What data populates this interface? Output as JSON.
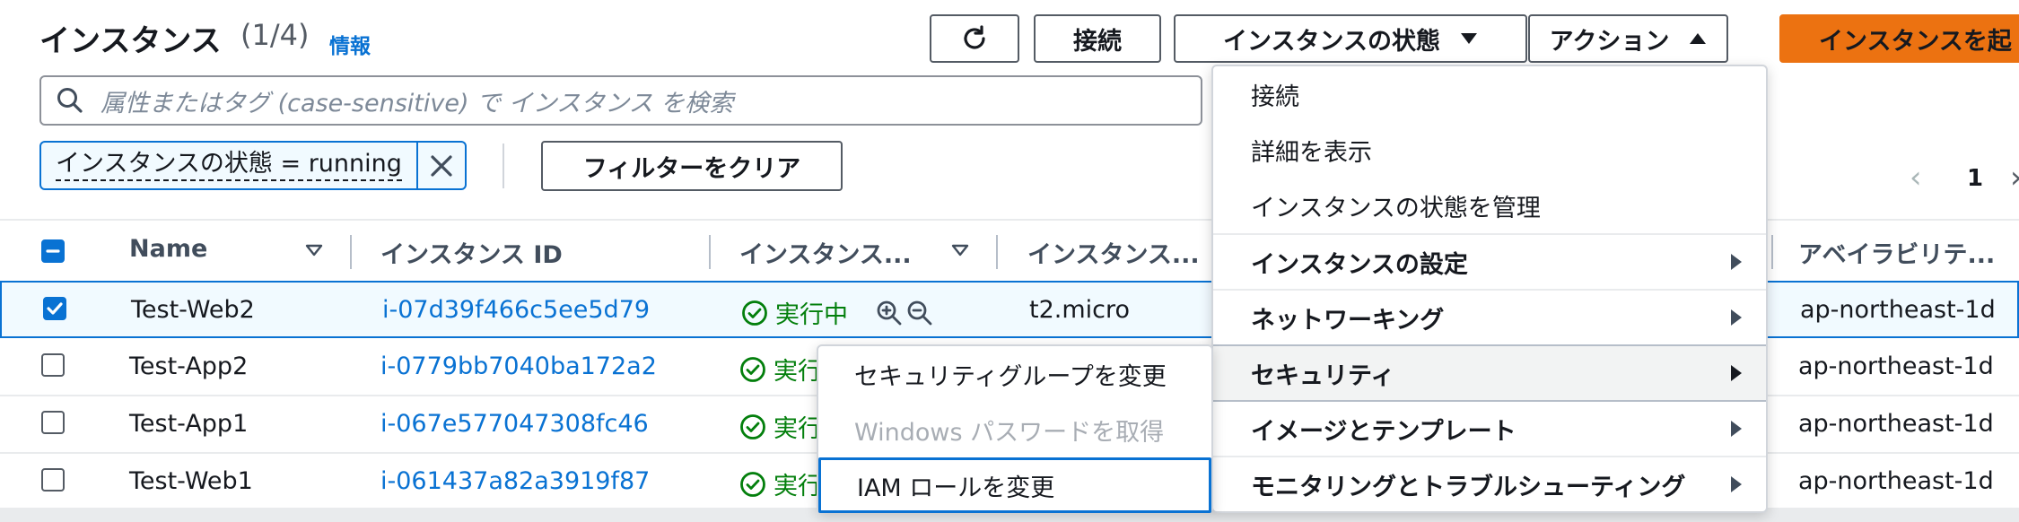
{
  "header": {
    "title": "インスタンス",
    "count": "(1/4)",
    "info_link": "情報"
  },
  "toolbar": {
    "connect_label": "接続",
    "instance_state_label": "インスタンスの状態",
    "actions_label": "アクション",
    "launch_label": "インスタンスを起"
  },
  "search": {
    "placeholder": "属性またはタグ (case-sensitive) で インスタンス を検索"
  },
  "filter": {
    "token_label": "インスタンスの状態 = running",
    "clear_label": "フィルターをクリア"
  },
  "pagination": {
    "current_page": "1"
  },
  "table": {
    "columns": {
      "name": "Name",
      "instance_id": "インスタンス ID",
      "instance_state": "インスタンス...",
      "instance_type": "インスタンス...",
      "availability_zone": "アベイラビリテ..."
    },
    "rows": [
      {
        "name": "Test-Web2",
        "id": "i-07d39f466c5ee5d79",
        "state": "実行中",
        "type": "t2.micro",
        "az": "ap-northeast-1d",
        "selected": true
      },
      {
        "name": "Test-App2",
        "id": "i-0779bb7040ba172a2",
        "state": "実行",
        "type": "",
        "az": "ap-northeast-1d",
        "selected": false
      },
      {
        "name": "Test-App1",
        "id": "i-067e577047308fc46",
        "state": "実行",
        "type": "",
        "az": "ap-northeast-1d",
        "selected": false
      },
      {
        "name": "Test-Web1",
        "id": "i-061437a82a3919f87",
        "state": "実行",
        "type": "",
        "az": "ap-northeast-1d",
        "selected": false
      }
    ]
  },
  "actions_menu": {
    "items": [
      {
        "label": "接続"
      },
      {
        "label": "詳細を表示"
      },
      {
        "label": "インスタンスの状態を管理"
      },
      {
        "label": "インスタンスの設定"
      },
      {
        "label": "ネットワーキング"
      },
      {
        "label": "セキュリティ"
      },
      {
        "label": "イメージとテンプレート"
      },
      {
        "label": "モニタリングとトラブルシューティング"
      }
    ]
  },
  "security_submenu": {
    "items": [
      {
        "label": "セキュリティグループを変更",
        "disabled": false
      },
      {
        "label": "Windows パスワードを取得",
        "disabled": true
      },
      {
        "label": "IAM ロールを変更",
        "disabled": false
      }
    ]
  },
  "colors": {
    "link": "#0972d3",
    "running": "#037f0c",
    "primary": "#ec7211"
  }
}
